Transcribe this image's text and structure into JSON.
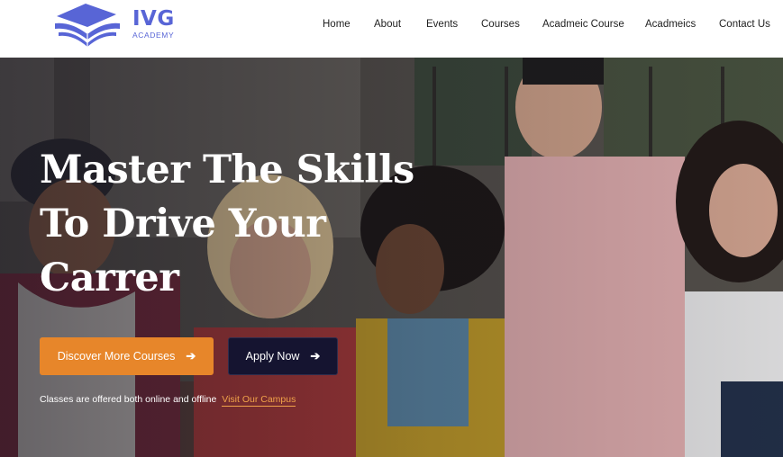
{
  "brand": {
    "name": "IVG",
    "subtitle": "ACADEMY",
    "color": "#5865d6"
  },
  "nav": {
    "items": [
      {
        "label": "Home"
      },
      {
        "label": "About"
      },
      {
        "label": "Events"
      },
      {
        "label": "Courses"
      },
      {
        "label": "Acadmeic Course"
      },
      {
        "label": "Acadmeics"
      },
      {
        "label": "Contact Us"
      }
    ]
  },
  "hero": {
    "title_lines": [
      "Master The Skills",
      "To Drive Your",
      "Carrer"
    ],
    "primary_button": {
      "label": "Discover More Courses",
      "icon": "arrow-right-icon",
      "color": "#e7862a"
    },
    "secondary_button": {
      "label": "Apply Now",
      "icon": "arrow-right-icon",
      "color": "#151430"
    },
    "info_text": "Classes are offered both online and offline",
    "info_link": "Visit Our Campus",
    "link_color": "#f0a24a"
  }
}
